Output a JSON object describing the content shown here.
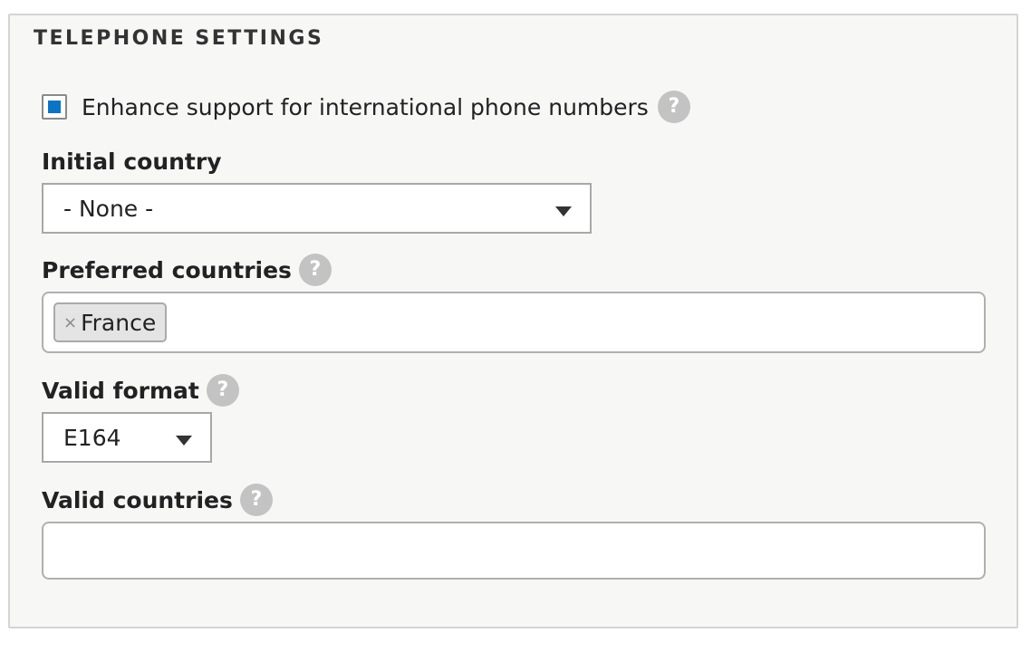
{
  "section": {
    "title": "TELEPHONE SETTINGS"
  },
  "enhance": {
    "label": "Enhance support for international phone numbers",
    "checked": true,
    "help_icon": "?"
  },
  "initial_country": {
    "label": "Initial country",
    "value": "- None -"
  },
  "preferred_countries": {
    "label": "Preferred countries",
    "help_icon": "?",
    "tags": [
      {
        "remove": "×",
        "label": "France"
      }
    ]
  },
  "valid_format": {
    "label": "Valid format",
    "help_icon": "?",
    "value": "E164"
  },
  "valid_countries": {
    "label": "Valid countries",
    "help_icon": "?",
    "tags": []
  },
  "colors": {
    "accent": "#0b74c4",
    "help_bg": "#c3c3c3",
    "panel_bg": "#f7f7f6"
  }
}
